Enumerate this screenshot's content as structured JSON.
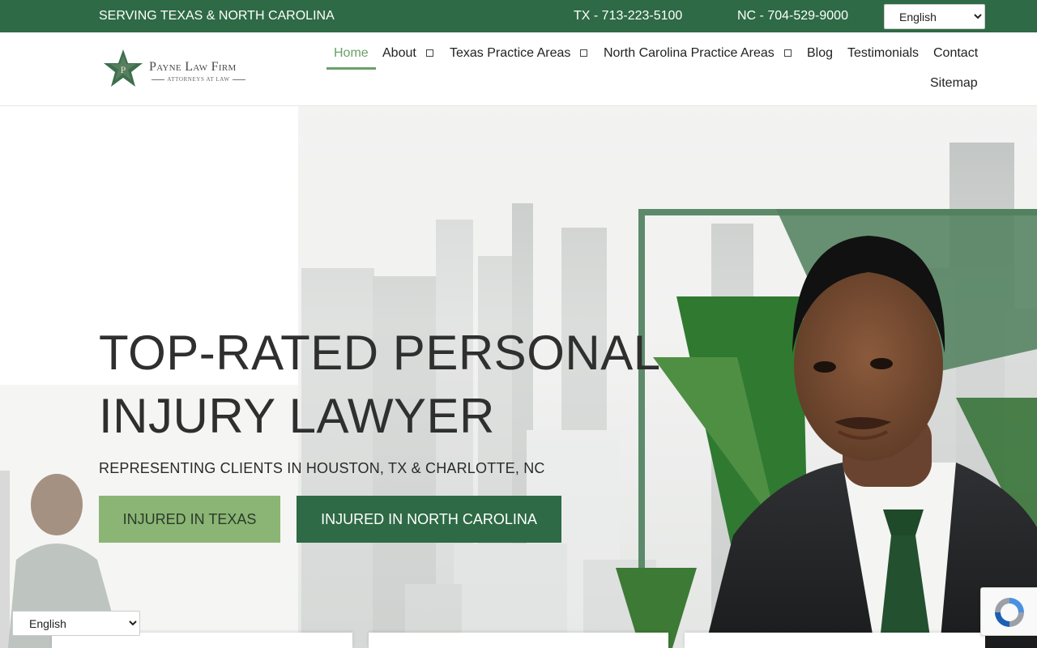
{
  "topbar": {
    "serving": "SERVING TEXAS & NORTH CAROLINA",
    "phone_tx": "TX - 713-223-5100",
    "phone_nc": "NC - 704-529-9000",
    "language": "English"
  },
  "logo": {
    "name": "Payne Law Firm",
    "subtitle": "ATTORNEYS AT LAW",
    "monogram": "P"
  },
  "nav": {
    "home": "Home",
    "about": "About",
    "texas": "Texas Practice Areas",
    "nc": "North Carolina Practice Areas",
    "blog": "Blog",
    "testimonials": "Testimonials",
    "contact": "Contact",
    "sitemap": "Sitemap"
  },
  "hero": {
    "title_line1": "TOP-RATED PERSONAL",
    "title_line2": "INJURY LAWYER",
    "subtitle": "REPRESENTING CLIENTS IN HOUSTON, TX & CHARLOTTE, NC",
    "btn_texas": "INJURED IN TEXAS",
    "btn_nc": "INJURED IN NORTH CAROLINA"
  },
  "footer_language": "English",
  "colors": {
    "brand_green": "#2e6a45",
    "light_green": "#8bb574",
    "active_nav": "#6aa06a"
  },
  "icons": [
    "star-logo-icon",
    "caret-icon",
    "recaptcha-icon"
  ]
}
